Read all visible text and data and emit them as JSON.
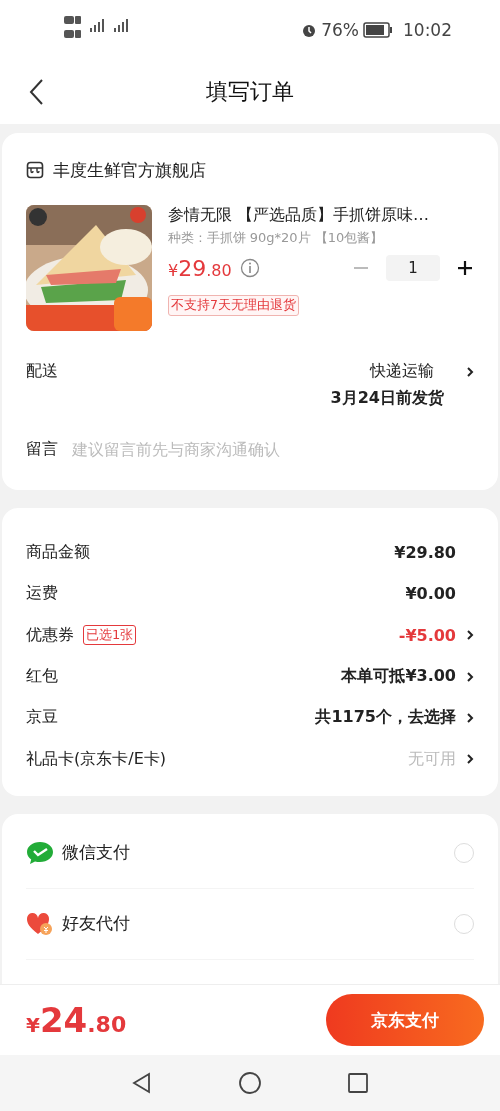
{
  "status_bar": {
    "battery": "76%",
    "time": "10:02"
  },
  "header": {
    "title": "填写订单"
  },
  "store": {
    "name": "丰度生鲜官方旗舰店"
  },
  "product": {
    "title": "参情无限  【严选品质】手抓饼原味…",
    "spec": "种类 : 手抓饼 90g*20片 【10包酱】",
    "price": {
      "currency": "¥",
      "whole": "29",
      "fraction": ".80"
    },
    "quantity": "1",
    "decrease_disabled": true,
    "tag": "不支持7天无理由退货"
  },
  "delivery": {
    "label": "配送",
    "method": "快递运输",
    "note": "3月24日前发货"
  },
  "message": {
    "label": "留言",
    "placeholder": "建议留言前先与商家沟通确认"
  },
  "summary": [
    {
      "label": "商品金额",
      "value": "¥29.80",
      "kind": "normal",
      "arrow": false
    },
    {
      "label": "运费",
      "value": "¥0.00",
      "kind": "normal",
      "arrow": false
    },
    {
      "label": "优惠券",
      "tag": "已选1张",
      "value": "-¥5.00",
      "kind": "discount",
      "arrow": true
    },
    {
      "label": "红包",
      "value": "本单可抵¥3.00",
      "kind": "normal",
      "arrow": true
    },
    {
      "label": "京豆",
      "value": "共1175个，去选择",
      "kind": "normal",
      "arrow": true
    },
    {
      "label": "礼品卡(京东卡/E卡)",
      "value": "无可用",
      "kind": "unavailable",
      "arrow": true
    }
  ],
  "payments": [
    {
      "kind": "wechat",
      "name": "微信支付",
      "selected": false
    },
    {
      "kind": "friend",
      "name": "好友代付",
      "selected": false
    }
  ],
  "footer": {
    "total": {
      "currency": "¥",
      "whole": "24",
      "fraction": ".80"
    },
    "button": "京东支付"
  }
}
